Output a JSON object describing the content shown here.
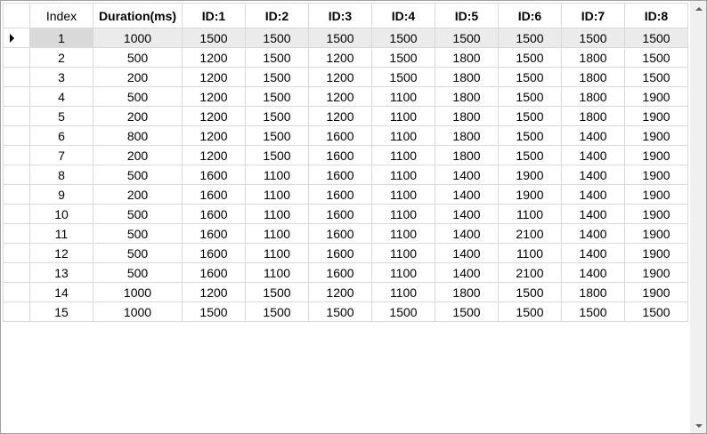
{
  "grid": {
    "columns": [
      "Index",
      "Duration(ms)",
      "ID:1",
      "ID:2",
      "ID:3",
      "ID:4",
      "ID:5",
      "ID:6",
      "ID:7",
      "ID:8"
    ],
    "selected_row": 0,
    "rows": [
      [
        "1",
        "1000",
        "1500",
        "1500",
        "1500",
        "1500",
        "1500",
        "1500",
        "1500",
        "1500"
      ],
      [
        "2",
        "500",
        "1200",
        "1500",
        "1200",
        "1500",
        "1800",
        "1500",
        "1800",
        "1500"
      ],
      [
        "3",
        "200",
        "1200",
        "1500",
        "1200",
        "1500",
        "1800",
        "1500",
        "1800",
        "1500"
      ],
      [
        "4",
        "500",
        "1200",
        "1500",
        "1200",
        "1100",
        "1800",
        "1500",
        "1800",
        "1900"
      ],
      [
        "5",
        "200",
        "1200",
        "1500",
        "1200",
        "1100",
        "1800",
        "1500",
        "1800",
        "1900"
      ],
      [
        "6",
        "800",
        "1200",
        "1500",
        "1600",
        "1100",
        "1800",
        "1500",
        "1400",
        "1900"
      ],
      [
        "7",
        "200",
        "1200",
        "1500",
        "1600",
        "1100",
        "1800",
        "1500",
        "1400",
        "1900"
      ],
      [
        "8",
        "500",
        "1600",
        "1100",
        "1600",
        "1100",
        "1400",
        "1900",
        "1400",
        "1900"
      ],
      [
        "9",
        "200",
        "1600",
        "1100",
        "1600",
        "1100",
        "1400",
        "1900",
        "1400",
        "1900"
      ],
      [
        "10",
        "500",
        "1600",
        "1100",
        "1600",
        "1100",
        "1400",
        "1100",
        "1400",
        "1900"
      ],
      [
        "11",
        "500",
        "1600",
        "1100",
        "1600",
        "1100",
        "1400",
        "2100",
        "1400",
        "1900"
      ],
      [
        "12",
        "500",
        "1600",
        "1100",
        "1600",
        "1100",
        "1400",
        "1100",
        "1400",
        "1900"
      ],
      [
        "13",
        "500",
        "1600",
        "1100",
        "1600",
        "1100",
        "1400",
        "2100",
        "1400",
        "1900"
      ],
      [
        "14",
        "1000",
        "1200",
        "1500",
        "1200",
        "1100",
        "1800",
        "1500",
        "1800",
        "1900"
      ],
      [
        "15",
        "1000",
        "1500",
        "1500",
        "1500",
        "1500",
        "1500",
        "1500",
        "1500",
        "1500"
      ]
    ]
  },
  "icons": {
    "current_row": "row-pointer-icon",
    "scroll_up": "scroll-up-arrow-icon",
    "scroll_down": "scroll-down-arrow-icon"
  },
  "colors": {
    "selected_row_bg": "#ebebeb",
    "selected_cell_bg": "#d9d9d9",
    "grid_line": "#d9d9d9"
  }
}
